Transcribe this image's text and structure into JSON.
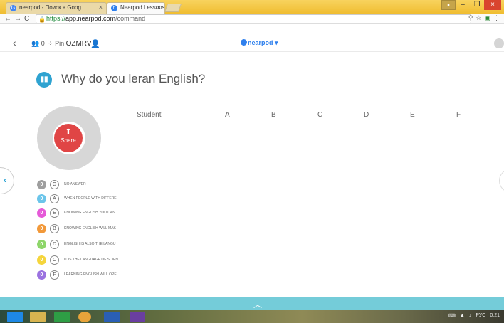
{
  "browser": {
    "tabs": [
      {
        "label": "nearpod - Поиск в Goog",
        "icon": "G"
      },
      {
        "label": "Nearpod Lessons: Downl",
        "icon": "n"
      }
    ],
    "url_https": "https://",
    "url_host": "app.nearpod.com",
    "url_path": "/command"
  },
  "app": {
    "students_label": "0",
    "pin_label": "Pin",
    "pin_code": "OZMRV",
    "logo_text": "nearpod"
  },
  "question": {
    "title": "Why do you leran English?"
  },
  "share": {
    "label": "Share"
  },
  "table": {
    "columns": [
      "Student",
      "A",
      "B",
      "C",
      "D",
      "E",
      "F"
    ]
  },
  "legend": [
    {
      "count": "0",
      "letter": "G",
      "text": "NO ANSWER",
      "color": "#9e9e9e"
    },
    {
      "count": "0",
      "letter": "A",
      "text": "WHEN PEOPLE WITH DIFFERE",
      "color": "#6bc5ea"
    },
    {
      "count": "0",
      "letter": "E",
      "text": "KNOWING ENGLISH YOU CAN",
      "color": "#e55ad8"
    },
    {
      "count": "0",
      "letter": "B",
      "text": "KNOWING ENGLISH WILL MAK",
      "color": "#f2993a"
    },
    {
      "count": "0",
      "letter": "D",
      "text": "ENGLISH IS ALSO THE LANGU",
      "color": "#8ed66a"
    },
    {
      "count": "0",
      "letter": "C",
      "text": "IT IS THE LANGUAGE OF SCIEN",
      "color": "#f5d53c"
    },
    {
      "count": "0",
      "letter": "F",
      "text": "LEARNING ENGLISH WILL OPE",
      "color": "#9b72e0"
    }
  ],
  "taskbar": {
    "lang": "РУС",
    "time": "0:21"
  }
}
